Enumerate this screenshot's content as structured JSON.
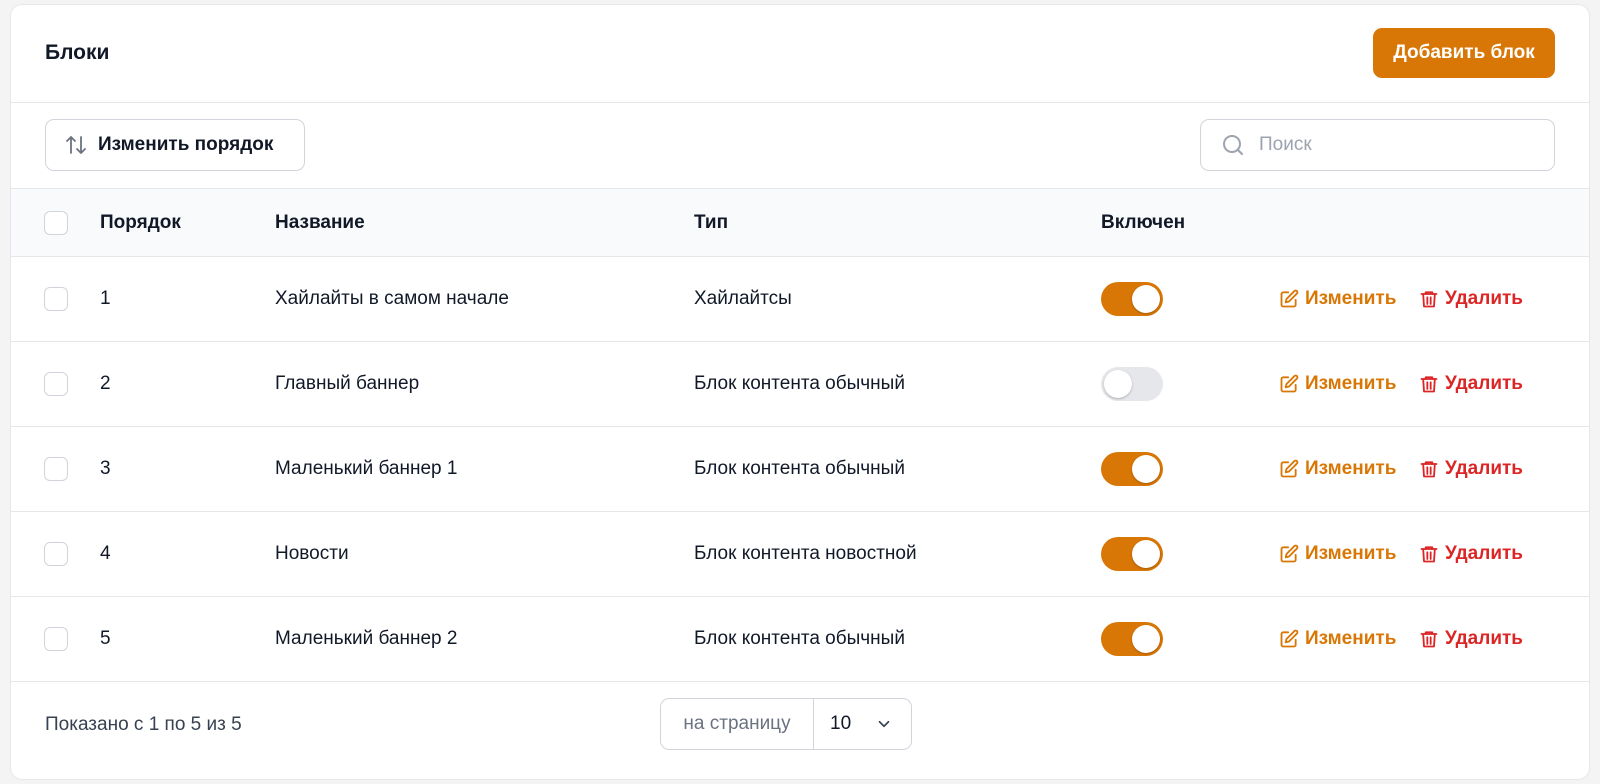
{
  "header": {
    "title": "Блоки",
    "add_button": "Добавить блок"
  },
  "toolbar": {
    "reorder_button": "Изменить порядок",
    "search_placeholder": "Поиск",
    "search_value": ""
  },
  "table": {
    "columns": {
      "order": "Порядок",
      "name": "Название",
      "type": "Тип",
      "enabled": "Включен"
    },
    "rows": [
      {
        "order": "1",
        "name": "Хайлайты в самом начале",
        "type": "Хайлайтсы",
        "enabled": true,
        "edit": "Изменить",
        "delete": "Удалить"
      },
      {
        "order": "2",
        "name": "Главный баннер",
        "type": "Блок контента обычный",
        "enabled": false,
        "edit": "Изменить",
        "delete": "Удалить"
      },
      {
        "order": "3",
        "name": "Маленький баннер 1",
        "type": "Блок контента обычный",
        "enabled": true,
        "edit": "Изменить",
        "delete": "Удалить"
      },
      {
        "order": "4",
        "name": "Новости",
        "type": "Блок контента новостной",
        "enabled": true,
        "edit": "Изменить",
        "delete": "Удалить"
      },
      {
        "order": "5",
        "name": "Маленький баннер 2",
        "type": "Блок контента обычный",
        "enabled": true,
        "edit": "Изменить",
        "delete": "Удалить"
      }
    ]
  },
  "footer": {
    "shown_text": "Показано с 1 по 5 из 5",
    "per_page_label": "на страницу",
    "per_page_value": "10"
  },
  "colors": {
    "accent": "#d97706",
    "danger": "#dc2626",
    "toggle_off": "#e5e7eb"
  },
  "icons": {
    "reorder": "arrows-up-down-icon",
    "search": "search-icon",
    "edit": "edit-icon",
    "delete": "trash-icon",
    "chevron": "chevron-down-icon"
  }
}
